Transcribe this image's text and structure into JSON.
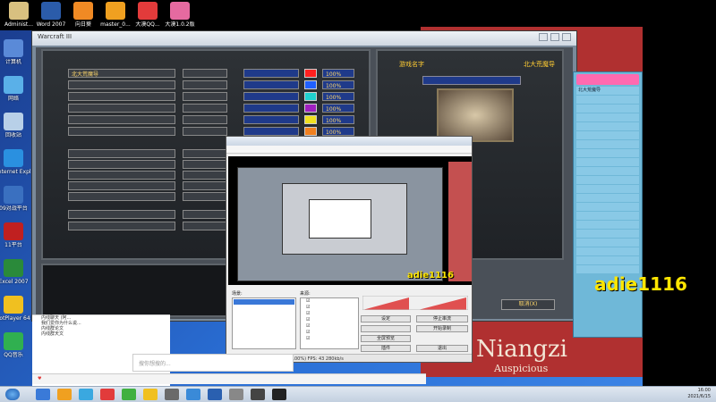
{
  "desktop": {
    "top_icons": [
      {
        "label": "Administ...",
        "icon": "folder-icon",
        "color": "#d8c080"
      },
      {
        "label": "Word 2007",
        "icon": "word-icon",
        "color": "#2b5caa"
      },
      {
        "label": "向日葵",
        "icon": "sunflower-icon",
        "color": "#f08a24"
      },
      {
        "label": "master_0...",
        "icon": "question-icon",
        "color": "#f0a020"
      },
      {
        "label": "大漠QQ...",
        "icon": "qq-icon",
        "color": "#e23b3b"
      },
      {
        "label": "大漠1.0.2版",
        "icon": "game-icon",
        "color": "#e56aa0"
      }
    ],
    "left_icons": [
      {
        "label": "计算机",
        "icon": "computer-icon",
        "color": "#5a8ad8"
      },
      {
        "label": "网络",
        "icon": "network-icon",
        "color": "#5ab0e8"
      },
      {
        "label": "回收站",
        "icon": "recycle-bin-icon",
        "color": "#b8d0e8"
      },
      {
        "label": "Internet Explorer",
        "icon": "ie-icon",
        "color": "#2a90e0"
      },
      {
        "label": "09对战平台",
        "icon": "platform-icon",
        "color": "#3a70c0"
      },
      {
        "label": "11平台",
        "icon": "eleven-icon",
        "color": "#c02020"
      },
      {
        "label": "Excel 2007",
        "icon": "excel-icon",
        "color": "#2a8a3a"
      },
      {
        "label": "PotPlayer 64 bit",
        "icon": "potplayer-icon",
        "color": "#f0c020"
      },
      {
        "label": "QQ音乐",
        "icon": "qqmusic-icon",
        "color": "#30b050"
      }
    ]
  },
  "game": {
    "window_title": "Warcraft III",
    "section_players": "",
    "section_computers": "",
    "section_observers": "",
    "player_slots": [
      {
        "name": "北大荒魔导",
        "state": "",
        "team": "",
        "color": "#ff2020",
        "pct": "100%"
      },
      {
        "name": "",
        "state": "",
        "team": "",
        "color": "#2060ff",
        "pct": "100%"
      },
      {
        "name": "",
        "state": "",
        "team": "",
        "color": "#20d0d0",
        "pct": "100%"
      },
      {
        "name": "",
        "state": "",
        "team": "",
        "color": "#a020c0",
        "pct": "100%"
      },
      {
        "name": "",
        "state": "",
        "team": "",
        "color": "#f0e020",
        "pct": "100%"
      },
      {
        "name": "",
        "state": "",
        "team": "",
        "color": "#f08020",
        "pct": "100%"
      }
    ],
    "computer_slots": [
      {
        "name": "",
        "state": "",
        "team": "",
        "color": "",
        "pct": ""
      },
      {
        "name": "",
        "state": "",
        "team": "",
        "color": "",
        "pct": ""
      },
      {
        "name": "",
        "state": "",
        "team": "",
        "color": "",
        "pct": ""
      },
      {
        "name": "",
        "state": "",
        "team": "",
        "color": "",
        "pct": ""
      },
      {
        "name": "",
        "state": "",
        "team": "",
        "color": "",
        "pct": ""
      }
    ],
    "observer_slots": [
      {
        "name": "",
        "state": ""
      },
      {
        "name": "",
        "state": ""
      }
    ],
    "map_title": "游戏名字",
    "host_name": "北大荒魔导",
    "map_name": "",
    "info_lines": [
      "",
      "",
      "",
      "",
      "",
      "",
      "",
      "",
      "",
      ""
    ],
    "chat_lines": [
      "",
      "",
      "",
      "",
      "",
      "",
      "",
      "",
      ""
    ],
    "cancel_label": "取消(X)"
  },
  "wallpaper": {
    "big": "Niangzi",
    "small": "Auspicious"
  },
  "sidelist": {
    "head": "",
    "rows": [
      "北大荒魔导",
      "",
      "",
      "",
      "",
      "",
      "",
      "",
      "",
      "",
      "",
      "",
      "",
      "",
      "",
      "",
      "",
      "",
      "",
      "",
      ""
    ]
  },
  "watermark": "adie1116",
  "obs": {
    "title": "",
    "menu": [
      "",
      "",
      "",
      "",
      "",
      ""
    ],
    "scenes_label": "场景:",
    "sources_label": "来源:",
    "sources": [
      "",
      "",
      "",
      "",
      "",
      "",
      ""
    ],
    "buttons": {
      "settings": "设定",
      "stop_stream": "停止串流",
      "preview": "",
      "start_record": "开始录制",
      "fullscreen": "全屏预览",
      "plugins": "插件",
      "exit": "退出"
    },
    "status": "0:00:01 (LIVE)      丢弃帧数: 0 (0.00%)      FPS: 43      280kb/s"
  },
  "qq": {
    "items": [
      "内线聊天 (阿...",
      "我们爱你为什么说...",
      "内线群论文",
      "内线群天文"
    ],
    "search_placeholder": "搜你想搜的...",
    "bar_left": "",
    "bar_mid": "",
    "bar_right": ""
  },
  "taskbar": {
    "time": "16:00",
    "date": "2021/6/15"
  }
}
